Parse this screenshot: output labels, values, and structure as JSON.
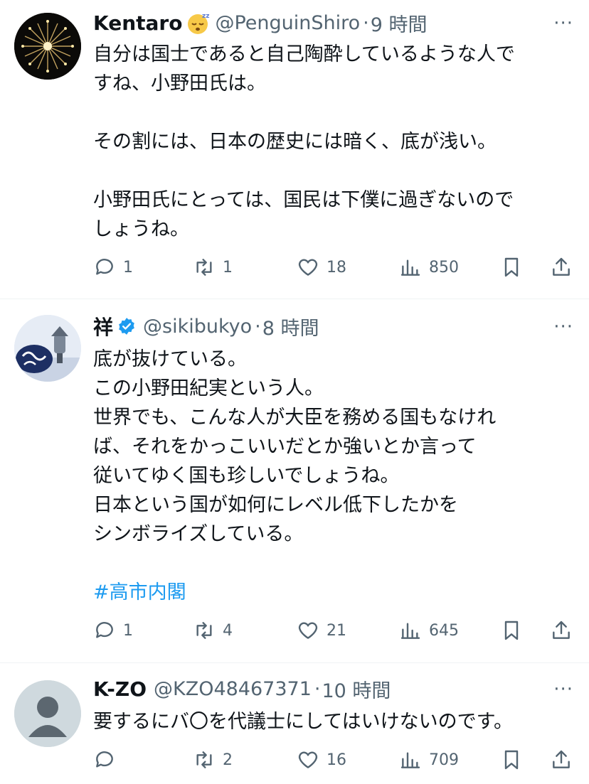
{
  "tweets": [
    {
      "name": "Kentaro",
      "name_emoji": "sleeping-face-emoji",
      "handle": "@PenguinShiro",
      "time_sep": "·",
      "time": "9 時間",
      "more": "···",
      "text": "自分は国士であると自己陶酔しているような人で\nすね、小野田氏は。\n\nその割には、日本の歴史には暗く、底が浅い。\n\n小野田氏にとっては、国民は下僕に過ぎないので\nしょうね。",
      "replies": "1",
      "retweets": "1",
      "likes": "18",
      "views": "850"
    },
    {
      "name": "祥",
      "verified": true,
      "handle": "@sikibukyo",
      "time_sep": "·",
      "time": "8 時間",
      "more": "···",
      "text": "底が抜けている。\nこの小野田紀実という人。\n世界でも、こんな人が大臣を務める国もなけれ\nば、それをかっこいいだとか強いとか言って\n従いてゆく国も珍しいでしょうね。\n日本という国が如何にレベル低下したかを\nシンボライズしている。",
      "hashtag": "#高市内閣",
      "replies": "1",
      "retweets": "4",
      "likes": "21",
      "views": "645"
    },
    {
      "name": "K-ZO",
      "handle": "@KZO48467371",
      "time_sep": "·",
      "time": "10 時間",
      "more": "···",
      "text": "要するにバ〇を代議士にしてはいけないのです。",
      "replies": "",
      "retweets": "2",
      "likes": "16",
      "views": "709"
    }
  ],
  "colors": {
    "text": "#0f1419",
    "secondary": "#536471",
    "accent": "#1d9bf0",
    "divider": "#eff3f4"
  }
}
